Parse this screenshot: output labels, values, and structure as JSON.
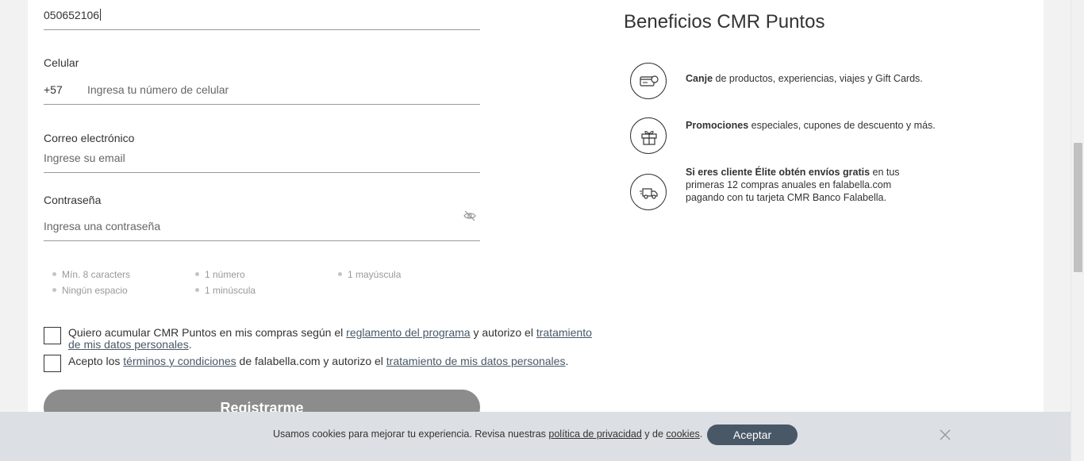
{
  "form": {
    "id_field": {
      "value": "050652106"
    },
    "phone": {
      "label": "Celular",
      "prefix": "+57",
      "placeholder": "Ingresa tu número de celular"
    },
    "email": {
      "label": "Correo electrónico",
      "placeholder": "Ingrese su email"
    },
    "password": {
      "label": "Contraseña",
      "placeholder": "Ingresa una contraseña"
    },
    "requirements": [
      "Mín. 8 caracters",
      "1 número",
      "1 mayúscula",
      "Ningún espacio",
      "1 minúscula"
    ],
    "consent_cmr": {
      "text_before": "Quiero acumular CMR Puntos en mis compras según el ",
      "link1": "reglamento del programa",
      "text_middle": "  y autorizo el ",
      "link2_line1": "tratamiento",
      "link2_line2": "de mis datos personales",
      "text_after": "."
    },
    "consent_terms": {
      "text_before": "Acepto los ",
      "link1": "términos y condiciones",
      "text_middle": " de falabella.com  y autorizo el ",
      "link2": "tratamiento de mis datos personales",
      "text_after": "."
    },
    "register_label": "Registrarme"
  },
  "benefits": {
    "title": "Beneficios CMR Puntos",
    "items": [
      {
        "icon": "card-points-icon",
        "bold": "Canje",
        "text": " de productos, experiencias, viajes y Gift Cards."
      },
      {
        "icon": "gift-icon",
        "bold": "Promociones",
        "text": " especiales, cupones de descuento y más."
      },
      {
        "icon": "delivery-truck-icon",
        "bold": "Si eres cliente Élite obtén envíos gratis",
        "text_line1": " en tus",
        "text_line2": "primeras 12 compras anuales en falabella.com",
        "text_line3": "pagando con tu tarjeta CMR Banco Falabella."
      }
    ]
  },
  "cookie_bar": {
    "text_before": "Usamos cookies para mejorar tu experiencia. Revisa nuestras ",
    "link_privacy": "política de privacidad",
    "text_middle": " y de ",
    "link_cookies": "cookies",
    "text_after": ".",
    "accept_label": "Aceptar"
  },
  "colors": {
    "accent": "#495867",
    "button_disabled": "#8c8c8c",
    "cookie_bg": "#dcdfe3"
  }
}
